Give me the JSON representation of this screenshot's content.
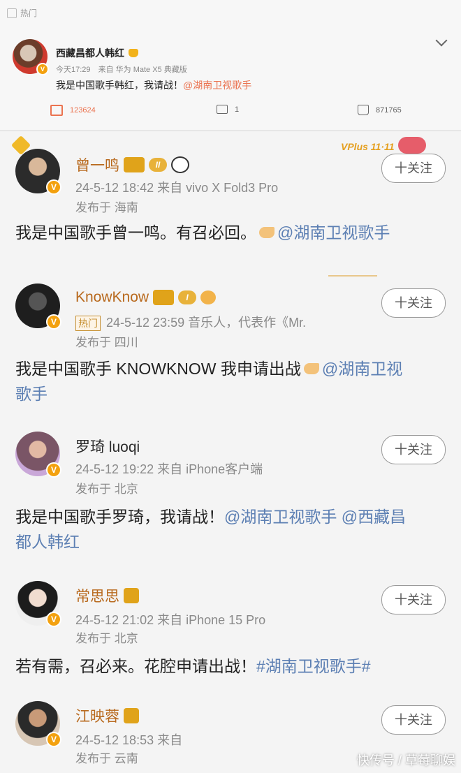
{
  "top_post": {
    "section_label": "热门",
    "author": "西藏昌都人韩红",
    "time": "今天17:29",
    "source": "来自 华为 Mate X5 典藏版",
    "content_prefix": "我是中国歌手韩红，我请战！",
    "content_mention": "@湖南卫视歌手",
    "repost_count": "123624",
    "comment_count": "1",
    "like_count": "871765"
  },
  "decorations": {
    "vplus_text": "VPlus 11·11"
  },
  "comments": [
    {
      "name": "曾一鸣",
      "level": "II",
      "time": "24-5-12 18:42",
      "source": "来自 vivo X Fold3 Pro",
      "location": "发布于 海南",
      "follow_label": "十关注",
      "text_prefix": "我是中国歌手曾一鸣。有召必回。",
      "text_mention": "@湖南卫视歌手"
    },
    {
      "name": "KnowKnow",
      "level": "I",
      "tag": "热门",
      "time": "24-5-12 23:59",
      "source": "音乐人，代表作《Mr.",
      "location": "发布于 四川",
      "follow_label": "十关注",
      "text_prefix": "我是中国歌手 KNOWKNOW 我申请出战",
      "text_mention": "@湖南卫视",
      "text_line2": "歌手"
    },
    {
      "name": "罗琦 luoqi",
      "time": "24-5-12 19:22",
      "source": "来自 iPhone客户端",
      "location": "发布于 北京",
      "follow_label": "十关注",
      "text_prefix": "我是中国歌手罗琦，我请战！",
      "text_mention": "@湖南卫视歌手 @西藏昌",
      "text_line2": "都人韩红"
    },
    {
      "name": "常思思",
      "time": "24-5-12 21:02",
      "source": "来自 iPhone 15 Pro",
      "location": "发布于 北京",
      "follow_label": "十关注",
      "text_prefix": "若有需，召必来。花腔申请出战！",
      "text_mention": "#湖南卫视歌手#"
    },
    {
      "name": "江映蓉",
      "time": "24-5-12 18:53",
      "source": "来自",
      "location": "发布于 云南",
      "follow_label": "十关注"
    }
  ],
  "watermark": "快传号 / 草莓聊娱"
}
